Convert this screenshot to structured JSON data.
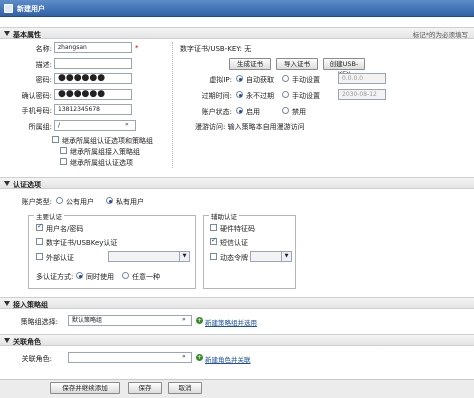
{
  "window": {
    "title": "新建用户"
  },
  "required_note": "标记*的为必须填写",
  "sections": {
    "basic": "基本属性",
    "auth": "认证选项",
    "policy": "接入策略组",
    "role": "关联角色"
  },
  "basic": {
    "name_label": "名称:",
    "name_value": "zhangsan",
    "name_req": "*",
    "desc_label": "描述:",
    "desc_value": "",
    "pwd_label": "密码:",
    "pwd_value": "●●●●●●",
    "pwd2_label": "确认密码:",
    "pwd2_value": "●●●●●●",
    "phone_label": "手机号码:",
    "phone_value": "13812345678",
    "group_label": "所属组:",
    "group_value": "/",
    "inherit_cb1": "继承所属组认证选项和策略组",
    "inherit_cb2": "继承所属组接入策略组",
    "inherit_cb3": "继承所属组认证选项",
    "cert_label": "数字证书/USB-KEY: 无",
    "gen_cert_btn": "生成证书",
    "import_cert_btn": "导入证书",
    "create_usbkey_btn": "创建USB-KEY",
    "vip_label": "虚拟IP:",
    "vip_auto": "自动获取",
    "vip_manual": "手动设置",
    "vip_value": "0.0.0.0",
    "expire_label": "过期时间:",
    "expire_never": "永不过期",
    "expire_manual": "手动设置",
    "expire_value": "2030-08-12",
    "status_label": "账户状态:",
    "status_enabled": "启用",
    "status_disabled": "禁用",
    "scope_label": "漫游访问: 输入策略本自用漫游访问"
  },
  "auth": {
    "acct_type_label": "账户类型:",
    "acct_public": "公有用户",
    "acct_private": "私有用户",
    "primary_title": "主要认证",
    "primary_items": [
      "用户名/密码",
      "数字证书/USBKey认证",
      "外部认证"
    ],
    "ext_select_value": "",
    "multi_label": "多认证方式:",
    "multi_all": "同时使用",
    "multi_any": "任意一种",
    "aux_title": "辅助认证",
    "aux_items": [
      "硬件特征码",
      "短信认证",
      "动态令牌"
    ],
    "token_select_value": ""
  },
  "policy": {
    "label": "策略组选择:",
    "value": "默认策略组",
    "link": "新建策略组并选用"
  },
  "role": {
    "label": "关联角色:",
    "value": "",
    "link": "新建角色并关联"
  },
  "buttons": {
    "save_add": "保存并继续添加",
    "save": "保存",
    "cancel": "取消"
  }
}
